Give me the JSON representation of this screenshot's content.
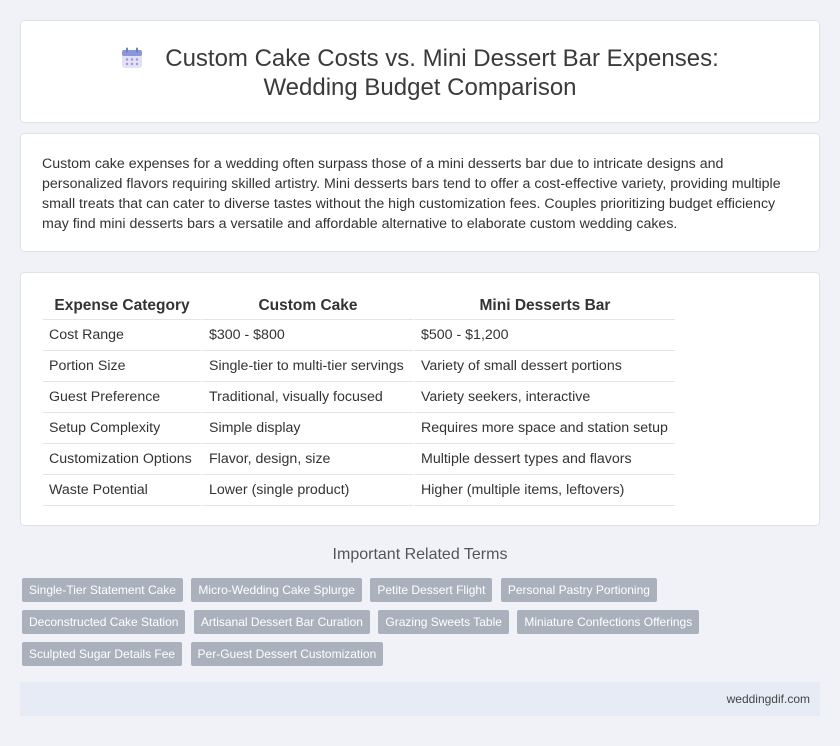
{
  "header": {
    "title": "Custom Cake Costs vs. Mini Dessert Bar Expenses: Wedding Budget Comparison"
  },
  "intro": {
    "text": "Custom cake expenses for a wedding often surpass those of a mini desserts bar due to intricate designs and personalized flavors requiring skilled artistry. Mini desserts bars tend to offer a cost-effective variety, providing multiple small treats that can cater to diverse tastes without the high customization fees. Couples prioritizing budget efficiency may find mini desserts bars a versatile and affordable alternative to elaborate custom wedding cakes."
  },
  "table": {
    "headers": [
      "Expense Category",
      "Custom Cake",
      "Mini Desserts Bar"
    ],
    "rows": [
      [
        "Cost Range",
        "$300 - $800",
        "$500 - $1,200"
      ],
      [
        "Portion Size",
        "Single-tier to multi-tier servings",
        "Variety of small dessert portions"
      ],
      [
        "Guest Preference",
        "Traditional, visually focused",
        "Variety seekers, interactive"
      ],
      [
        "Setup Complexity",
        "Simple display",
        "Requires more space and station setup"
      ],
      [
        "Customization Options",
        "Flavor, design, size",
        "Multiple dessert types and flavors"
      ],
      [
        "Waste Potential",
        "Lower (single product)",
        "Higher (multiple items, leftovers)"
      ]
    ]
  },
  "related": {
    "heading": "Important Related Terms",
    "tags": [
      "Single-Tier Statement Cake",
      "Micro-Wedding Cake Splurge",
      "Petite Dessert Flight",
      "Personal Pastry Portioning",
      "Deconstructed Cake Station",
      "Artisanal Dessert Bar Curation",
      "Grazing Sweets Table",
      "Miniature Confections Offerings",
      "Sculpted Sugar Details Fee",
      "Per-Guest Dessert Customization"
    ]
  },
  "footer": {
    "site": "weddingdif.com"
  },
  "icons": {
    "title_icon": "calendar-icon"
  },
  "colors": {
    "tag_bg": "#aab1bd",
    "footer_bg": "#e6ebf5",
    "page_bg": "#f0f2f7"
  }
}
